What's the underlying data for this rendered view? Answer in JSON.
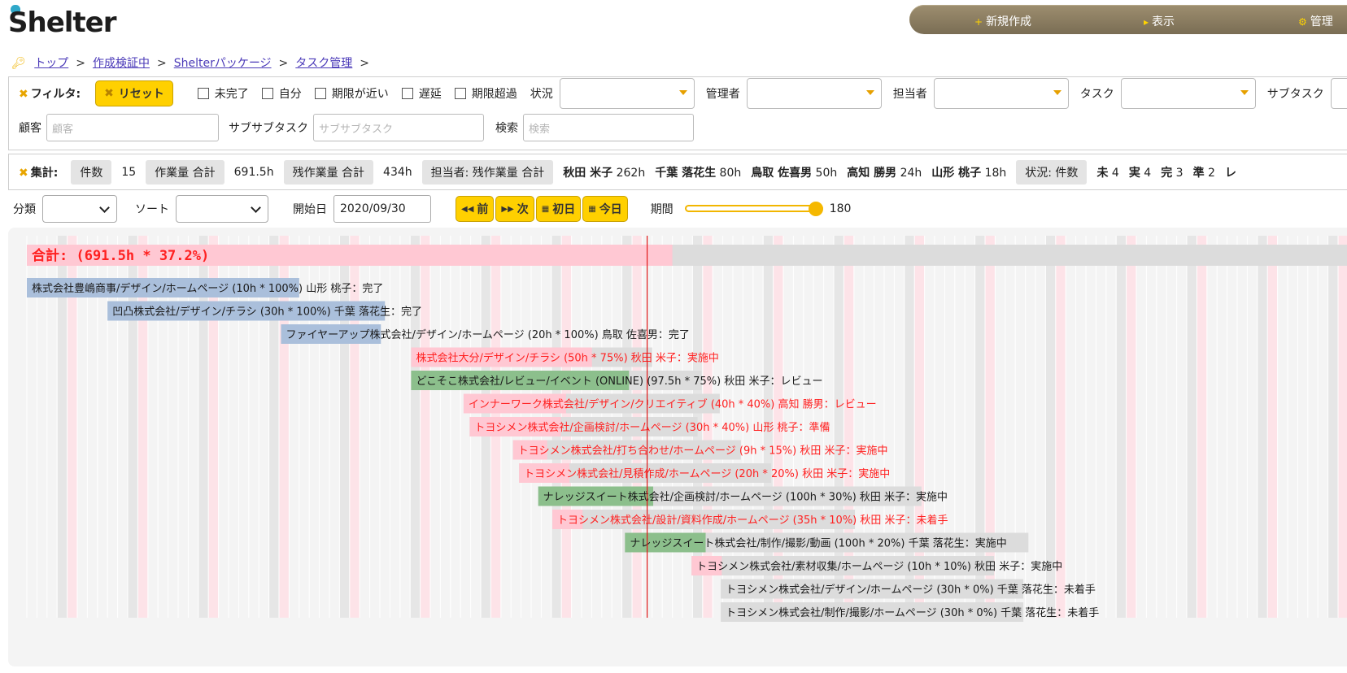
{
  "header": {
    "logo_text": "Shelter",
    "nav": [
      {
        "icon": "+",
        "label": "新規作成"
      },
      {
        "icon": "▸",
        "label": "表示"
      },
      {
        "icon": "⚙",
        "label": "管理"
      }
    ]
  },
  "breadcrumb": {
    "items": [
      "トップ",
      "作成検証中",
      "Shelterパッケージ",
      "タスク管理"
    ],
    "separator": ">"
  },
  "filter": {
    "title": "フィルタ:",
    "reset_label": "リセット",
    "checkboxes": [
      "未完了",
      "自分",
      "期限が近い",
      "遅延",
      "期限超過"
    ],
    "selects": [
      "状況",
      "管理者",
      "担当者",
      "タスク",
      "サブタスク"
    ],
    "customer_label": "顧客",
    "customer_placeholder": "顧客",
    "subsubtask_label": "サブサブタスク",
    "subsubtask_placeholder": "サブサブタスク",
    "search_label": "検索",
    "search_placeholder": "検索"
  },
  "summary": {
    "title": "集計:",
    "count_label": "件数",
    "count_value": "15",
    "work_label": "作業量 合計",
    "work_value": "691.5h",
    "remain_label": "残作業量 合計",
    "remain_value": "434h",
    "assignee_label": "担当者: 残作業量 合計",
    "assignees": [
      {
        "name": "秋田 米子",
        "hours": "262h"
      },
      {
        "name": "千葉 落花生",
        "hours": "80h"
      },
      {
        "name": "鳥取 佐喜男",
        "hours": "50h"
      },
      {
        "name": "高知 勝男",
        "hours": "24h"
      },
      {
        "name": "山形 桃子",
        "hours": "18h"
      }
    ],
    "status_label": "状況: 件数",
    "statuses": [
      {
        "name": "未",
        "count": "4"
      },
      {
        "name": "実",
        "count": "4"
      },
      {
        "name": "完",
        "count": "3"
      },
      {
        "name": "準",
        "count": "2"
      },
      {
        "name": "レ",
        "count": ""
      }
    ]
  },
  "controls": {
    "category_label": "分類",
    "sort_label": "ソート",
    "start_label": "開始日",
    "start_value": "2020/09/30",
    "prev_label": "前",
    "next_label": "次",
    "first_label": "初日",
    "today_label": "今日",
    "period_label": "期間",
    "period_value": "180",
    "period_max": 180
  },
  "colors": {
    "accent": "#ffd000",
    "done": "#aabfdb",
    "active": "#ffc8d3",
    "review": "#8cbf8c",
    "remaining": "#dcdcdc",
    "alert_text": "#ff2020",
    "today_line": "#e01818"
  },
  "gantt": {
    "total_label": "合計: (691.5h * 37.2%)",
    "today_day": 61.5,
    "tasks": [
      {
        "label": "株式会社豊嶋商事/デザイン/ホームページ (10h * 100%) 山形 桃子：完了",
        "start": 0,
        "days": 27,
        "progress": 1.0,
        "status": "done"
      },
      {
        "label": "凹凸株式会社/デザイン/チラシ (30h * 100%) 千葉 落花生：完了",
        "start": 8,
        "days": 27.5,
        "progress": 1.0,
        "status": "done"
      },
      {
        "label": "ファイヤーアップ株式会社/デザイン/ホームページ (20h * 100%) 鳥取 佐喜男：完了",
        "start": 25.2,
        "days": 9.9,
        "progress": 1.0,
        "status": "done"
      },
      {
        "label": "株式会社大分/デザイン/チラシ (50h * 75%) 秋田 米子：実施中",
        "start": 38.1,
        "days": 23.9,
        "progress": 0.75,
        "status": "active"
      },
      {
        "label": "どこそこ株式会社/レビュー/イベント (ONLINE) (97.5h * 75%) 秋田 米子：レビュー",
        "start": 38.1,
        "days": 28.8,
        "progress": 0.75,
        "status": "review"
      },
      {
        "label": "インナーワーク株式会社/デザイン/クリエイティブ (40h * 40%) 高知 勝男：レビュー",
        "start": 43.3,
        "days": 25.4,
        "progress": 0.4,
        "status": "active"
      },
      {
        "label": "トヨシメン株式会社/企画検討/ホームページ (30h * 40%) 山形 桃子：準備",
        "start": 43.9,
        "days": 22.6,
        "progress": 0.4,
        "status": "active"
      },
      {
        "label": "トヨシメン株式会社/打ち合わせ/ホームページ (9h * 15%) 秋田 米子：実施中",
        "start": 48.2,
        "days": 22.6,
        "progress": 0.15,
        "status": "active"
      },
      {
        "label": "トヨシメン株式会社/見積作成/ホームページ (20h * 20%) 秋田 米子：実施中",
        "start": 48.8,
        "days": 25.0,
        "progress": 0.2,
        "status": "active"
      },
      {
        "label": "ナレッジスイート株式会社/企画検討/ホームページ (100h * 30%) 秋田 米子：実施中",
        "start": 50.7,
        "days": 38.0,
        "progress": 0.3,
        "status": "review"
      },
      {
        "label": "トヨシメン株式会社/設計/資料作成/ホームページ (35h * 10%) 秋田 米子：未着手",
        "start": 52.1,
        "days": 30.0,
        "progress": 0.1,
        "status": "active"
      },
      {
        "label": "ナレッジスイート株式会社/制作/撮影/動画 (100h * 20%) 千葉 落花生：実施中",
        "start": 59.3,
        "days": 40.0,
        "progress": 0.2,
        "status": "review"
      },
      {
        "label": "トヨシメン株式会社/素材収集/ホームページ (10h * 10%) 秋田 米子：実施中",
        "start": 65.9,
        "days": 30.0,
        "progress": 0.1,
        "status": "remaining"
      },
      {
        "label": "トヨシメン株式会社/デザイン/ホームページ (30h * 0%) 千葉 落花生：未着手",
        "start": 68.8,
        "days": 30.0,
        "progress": 0.0,
        "status": "remaining"
      },
      {
        "label": "トヨシメン株式会社/制作/撮影/ホームページ (30h * 0%) 千葉 落花生：未着手",
        "start": 68.8,
        "days": 30.0,
        "progress": 0.0,
        "status": "remaining"
      }
    ]
  }
}
